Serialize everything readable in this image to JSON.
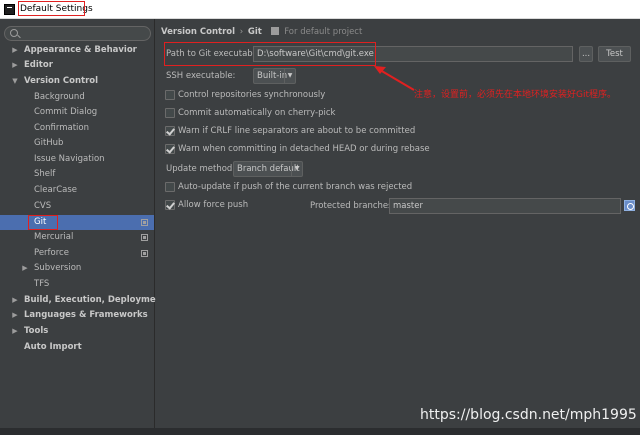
{
  "window": {
    "title": "Default Settings"
  },
  "sidebar": {
    "search_placeholder": "",
    "items": [
      {
        "label": "Appearance & Behavior",
        "arrow": "▶"
      },
      {
        "label": "Editor",
        "arrow": "▶"
      },
      {
        "label": "Version Control",
        "arrow": "▼"
      },
      {
        "label": "Background"
      },
      {
        "label": "Commit Dialog"
      },
      {
        "label": "Confirmation"
      },
      {
        "label": "GitHub"
      },
      {
        "label": "Issue Navigation"
      },
      {
        "label": "Shelf"
      },
      {
        "label": "ClearCase"
      },
      {
        "label": "CVS"
      },
      {
        "label": "Git"
      },
      {
        "label": "Mercurial"
      },
      {
        "label": "Perforce"
      },
      {
        "label": "Subversion",
        "arrow": "▶"
      },
      {
        "label": "TFS"
      },
      {
        "label": "Build, Execution, Deployment",
        "arrow": "▶"
      },
      {
        "label": "Languages & Frameworks",
        "arrow": "▶"
      },
      {
        "label": "Tools",
        "arrow": "▶"
      },
      {
        "label": "Auto Import"
      }
    ]
  },
  "breadcrumb": {
    "part1": "Version Control",
    "separator": "›",
    "part2": "Git",
    "scope": "For default project"
  },
  "git": {
    "path_label": "Path to Git executable:",
    "path_value": "D:\\software\\Git\\cmd\\git.exe",
    "browse_label": "...",
    "test_label": "Test",
    "ssh_label": "SSH executable:",
    "ssh_value": "Built-in",
    "options": [
      {
        "label": "Control repositories synchronously",
        "checked": false
      },
      {
        "label": "Commit automatically on cherry-pick",
        "checked": false
      },
      {
        "label": "Warn if CRLF line separators are about to be committed",
        "checked": true
      },
      {
        "label": "Warn when committing in detached HEAD or during rebase",
        "checked": true
      }
    ],
    "update_method_label": "Update method:",
    "update_method_value": "Branch default",
    "auto_update_label": "Auto-update if push of the current branch was rejected",
    "auto_update_checked": false,
    "allow_force_push_label": "Allow force push",
    "allow_force_push_checked": true,
    "protected_branches_label": "Protected branches:",
    "protected_branches_value": "master"
  },
  "annotation": {
    "text": "注意，设置前，必须先在本地环境安装好Git程序。",
    "color": "#e02020"
  },
  "watermark": {
    "text": "https://blog.csdn.net/mph1995"
  },
  "colors": {
    "selection": "#4b6eaf",
    "background": "#3c3f41",
    "annotation": "#e02020"
  }
}
